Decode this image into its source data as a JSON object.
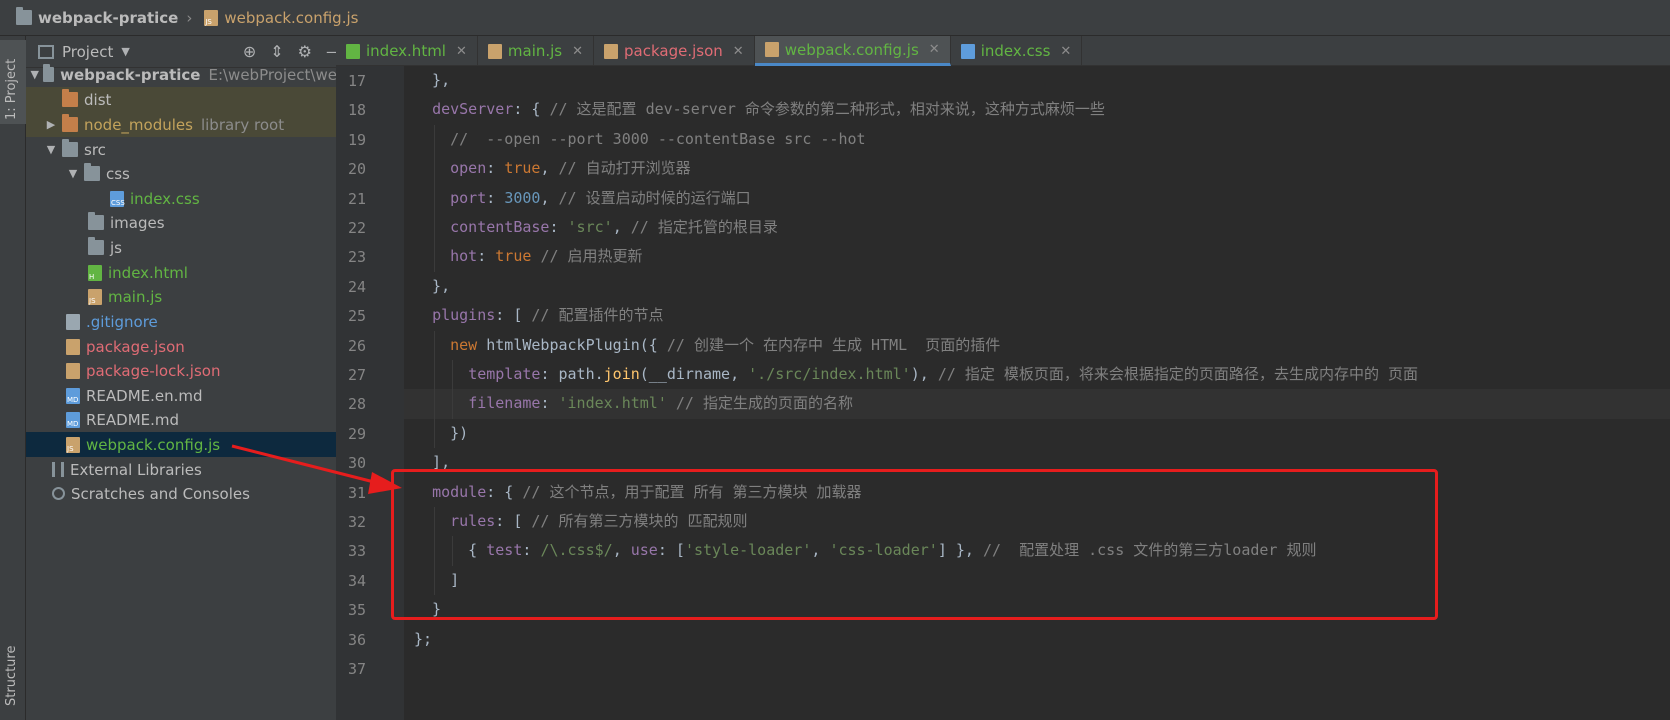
{
  "breadcrumb": {
    "project": "webpack-pratice",
    "file": "webpack.config.js"
  },
  "toolstrip": {
    "project_label": "1: Project",
    "structure_label": "Structure"
  },
  "project_panel": {
    "title": "Project",
    "root": {
      "name": "webpack-pratice",
      "path": "E:\\webProject\\webp"
    },
    "items": [
      {
        "label": "dist",
        "extra": ""
      },
      {
        "label": "node_modules",
        "extra": "library root"
      },
      {
        "label": "src",
        "extra": ""
      },
      {
        "label": "css",
        "extra": ""
      },
      {
        "label": "index.css",
        "extra": ""
      },
      {
        "label": "images",
        "extra": ""
      },
      {
        "label": "js",
        "extra": ""
      },
      {
        "label": "index.html",
        "extra": ""
      },
      {
        "label": "main.js",
        "extra": ""
      },
      {
        "label": ".gitignore",
        "extra": ""
      },
      {
        "label": "package.json",
        "extra": ""
      },
      {
        "label": "package-lock.json",
        "extra": ""
      },
      {
        "label": "README.en.md",
        "extra": ""
      },
      {
        "label": "README.md",
        "extra": ""
      },
      {
        "label": "webpack.config.js",
        "extra": ""
      },
      {
        "label": "External Libraries",
        "extra": ""
      },
      {
        "label": "Scratches and Consoles",
        "extra": ""
      }
    ]
  },
  "tabs": [
    {
      "label": "index.html"
    },
    {
      "label": "main.js"
    },
    {
      "label": "package.json"
    },
    {
      "label": "webpack.config.js"
    },
    {
      "label": "index.css"
    }
  ],
  "editor": {
    "line_numbers": [
      "17",
      "18",
      "19",
      "20",
      "21",
      "22",
      "23",
      "24",
      "25",
      "26",
      "27",
      "28",
      "29",
      "30",
      "31",
      "32",
      "33",
      "34",
      "35",
      "36",
      "37"
    ],
    "current_line": "28",
    "lines": [
      "  },",
      "  devServer: { // 这是配置 dev-server 命令参数的第二种形式，相对来说，这种方式麻烦一些",
      "    //  --open --port 3000 --contentBase src --hot",
      "    open: true, // 自动打开浏览器",
      "    port: 3000, // 设置启动时候的运行端口",
      "    contentBase: 'src', // 指定托管的根目录",
      "    hot: true // 启用热更新",
      "  },",
      "  plugins: [ // 配置插件的节点",
      "    new htmlWebpackPlugin({ // 创建一个 在内存中 生成 HTML  页面的插件",
      "      template: path.join(__dirname, './src/index.html'), // 指定 模板页面，将来会根据指定的页面路径，去生成内存中的 页面",
      "      filename: 'index.html' // 指定生成的页面的名称",
      "    })",
      "  ],",
      "  module: { // 这个节点，用于配置 所有 第三方模块 加载器",
      "    rules: [ // 所有第三方模块的 匹配规则",
      "      { test: /\\.css$/, use: ['style-loader', 'css-loader'] }, //  配置处理 .css 文件的第三方loader 规则",
      "    ]",
      "  }",
      "};",
      ""
    ]
  }
}
